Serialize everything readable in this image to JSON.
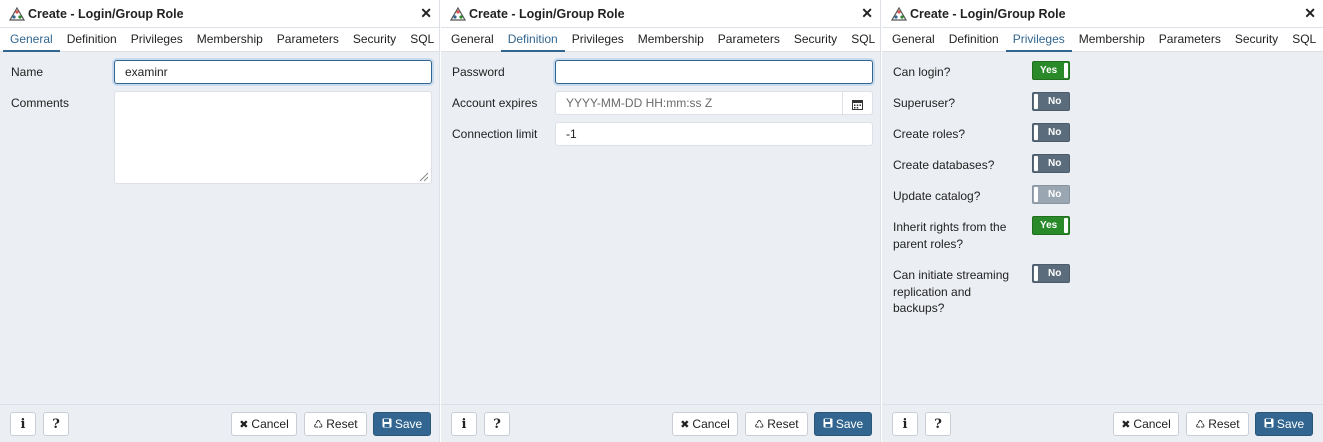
{
  "dialogs": [
    {
      "title": "Create - Login/Group Role",
      "tabs": [
        "General",
        "Definition",
        "Privileges",
        "Membership",
        "Parameters",
        "Security",
        "SQL"
      ],
      "active_tab": "General",
      "fields": {
        "name_label": "Name",
        "name_value": "examinr",
        "comments_label": "Comments"
      }
    },
    {
      "title": "Create - Login/Group Role",
      "tabs": [
        "General",
        "Definition",
        "Privileges",
        "Membership",
        "Parameters",
        "Security",
        "SQL"
      ],
      "active_tab": "Definition",
      "fields": {
        "password_label": "Password",
        "password_value": "",
        "account_expires_label": "Account expires",
        "account_expires_placeholder": "YYYY-MM-DD HH:mm:ss Z",
        "connection_limit_label": "Connection limit",
        "connection_limit_value": "-1"
      }
    },
    {
      "title": "Create - Login/Group Role",
      "tabs": [
        "General",
        "Definition",
        "Privileges",
        "Membership",
        "Parameters",
        "Security",
        "SQL"
      ],
      "active_tab": "Privileges",
      "privileges": [
        {
          "label": "Can login?",
          "value": "Yes",
          "state": "on"
        },
        {
          "label": "Superuser?",
          "value": "No",
          "state": "off"
        },
        {
          "label": "Create roles?",
          "value": "No",
          "state": "off"
        },
        {
          "label": "Create databases?",
          "value": "No",
          "state": "off"
        },
        {
          "label": "Update catalog?",
          "value": "No",
          "state": "disabled"
        },
        {
          "label": "Inherit rights from the parent roles?",
          "value": "Yes",
          "state": "on"
        },
        {
          "label": "Can initiate streaming replication and backups?",
          "value": "No",
          "state": "off"
        }
      ]
    }
  ],
  "footer": {
    "info_label": "i",
    "help_label": "?",
    "cancel_label": "Cancel",
    "reset_label": "Reset",
    "save_label": "Save"
  },
  "icons": {
    "close": "close-icon",
    "calendar": "calendar-icon",
    "cancel": "x-icon",
    "reset": "recycle-icon",
    "save": "floppy-disk-icon",
    "logo": "pgadmin-role-icon"
  },
  "colors": {
    "accent": "#326690",
    "toggle_on": "#2a8a2a",
    "toggle_off": "#5b6d7d",
    "toggle_disabled": "#9aa6b1",
    "panel_bg": "#ebeef3"
  }
}
